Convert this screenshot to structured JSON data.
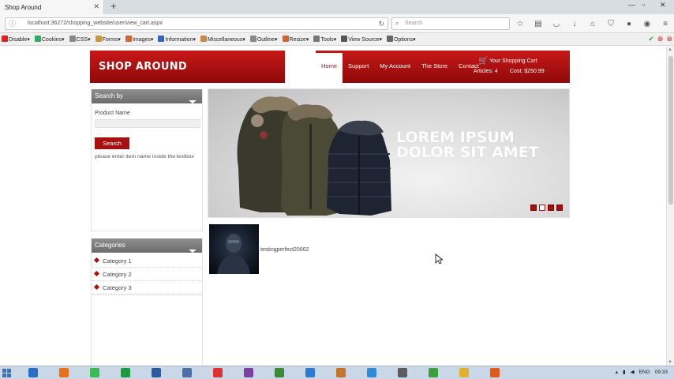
{
  "browser": {
    "tab_title": "Shop Around",
    "url": "localhost:36272/shopping_website/user/view_cart.aspx",
    "search_placeholder": "Search",
    "devbar": [
      {
        "label": "Disable▾",
        "color": "#d22"
      },
      {
        "label": "Cookies▾",
        "color": "#3a6"
      },
      {
        "label": "CSS▾",
        "color": "#888"
      },
      {
        "label": "Forms▾",
        "color": "#c93"
      },
      {
        "label": "Images▾",
        "color": "#c63"
      },
      {
        "label": "Information▾",
        "color": "#36b"
      },
      {
        "label": "Miscellaneous▾",
        "color": "#c84"
      },
      {
        "label": "Outline▾",
        "color": "#888"
      },
      {
        "label": "Resize▾",
        "color": "#c63"
      },
      {
        "label": "Tools▾",
        "color": "#777"
      },
      {
        "label": "View Source▾",
        "color": "#555"
      },
      {
        "label": "Options▾",
        "color": "#666"
      }
    ]
  },
  "site": {
    "logo": "SHOP AROUND",
    "nav": [
      {
        "label": "Home",
        "active": true
      },
      {
        "label": "Support",
        "active": false
      },
      {
        "label": "My Account",
        "active": false
      },
      {
        "label": "The Store",
        "active": false
      },
      {
        "label": "Contact",
        "active": false
      }
    ],
    "cart": {
      "title": "Your Shopping Cart",
      "articles": "Articles: 4",
      "cost": "Cost: $250.99"
    }
  },
  "search_panel": {
    "heading": "Search by",
    "product_label": "Product Name",
    "product_value": "",
    "button": "Search",
    "hint": "please enter item name inside the textbox"
  },
  "categories": {
    "heading": "Categories",
    "items": [
      "Category 1",
      "Category 2",
      "Category 3"
    ]
  },
  "banner": {
    "text": "LOREM IPSUM DOLOR SIT AMET",
    "slides": 4,
    "active_slide": 2
  },
  "product": {
    "name": "testingperfect20002"
  },
  "taskbar": {
    "lang": "ENG",
    "time": "09:33"
  },
  "colors": {
    "brand_red": "#a80f0f",
    "panel_gray": "#7a7a7a"
  }
}
